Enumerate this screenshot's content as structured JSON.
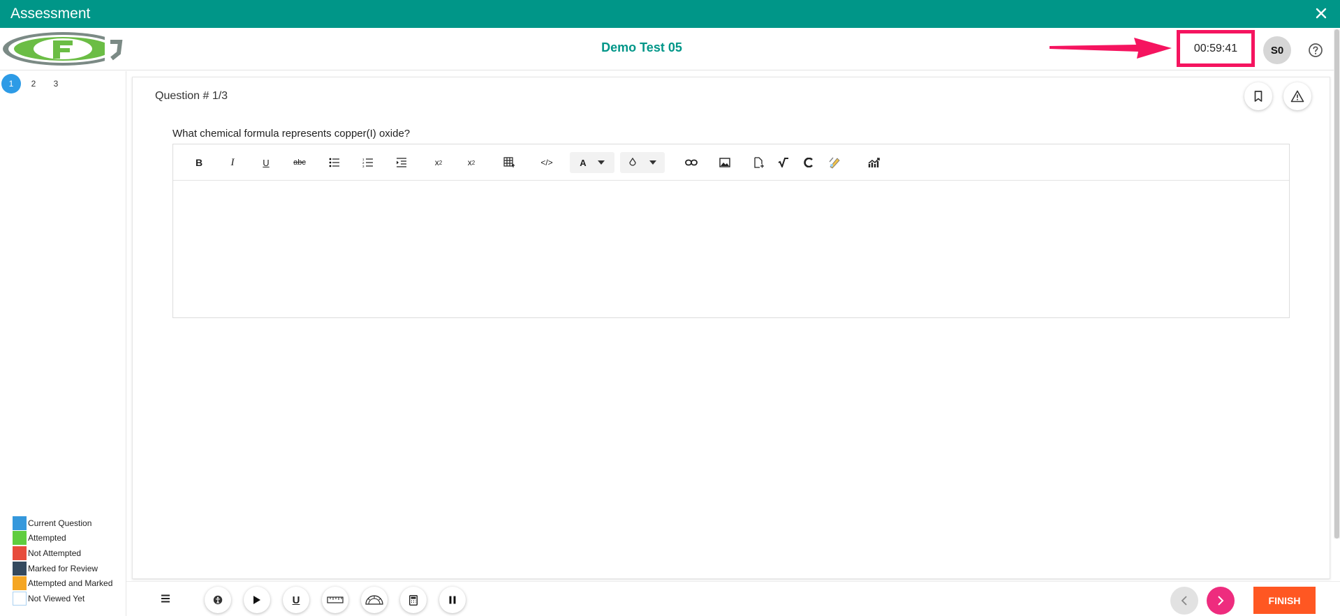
{
  "window": {
    "title": "Assessment",
    "close_icon": "close-icon"
  },
  "header": {
    "test_title": "Demo Test 05",
    "timer": "00:59:41",
    "avatar_initials": "S0",
    "help_icon": "help-circle-icon",
    "arrow_color": "#f5145f"
  },
  "sidebar": {
    "questions": [
      "1",
      "2",
      "3"
    ],
    "current": "1",
    "legend": [
      {
        "label": "Current Question",
        "color": "#3598dc"
      },
      {
        "label": "Attempted",
        "color": "#5fcd3f"
      },
      {
        "label": "Not Attempted",
        "color": "#e74c3c"
      },
      {
        "label": "Marked for Review",
        "color": "#34495e"
      },
      {
        "label": "Attempted and Marked",
        "color": "#f5a623"
      },
      {
        "label": "Not Viewed Yet",
        "color": "#ffffff"
      }
    ]
  },
  "question": {
    "header": "Question # 1/3",
    "text": "What chemical formula represents copper(I) oxide?",
    "answer_value": ""
  },
  "editor_toolbar": {
    "buttons": [
      "bold",
      "italic",
      "underline",
      "strikethrough",
      "bullet-list",
      "numbered-list",
      "indent",
      "subscript",
      "superscript",
      "table",
      "code",
      "text-color",
      "fill-color",
      "link",
      "image",
      "attachment",
      "math-formula",
      "chemistry",
      "drawing",
      "chart"
    ],
    "text_color_glyph": "A"
  },
  "bottom": {
    "tools": [
      "accessibility",
      "play",
      "underline",
      "ruler",
      "protractor",
      "calculator",
      "pause"
    ],
    "finish_label": "FINISH",
    "accent": "#ff5722"
  }
}
